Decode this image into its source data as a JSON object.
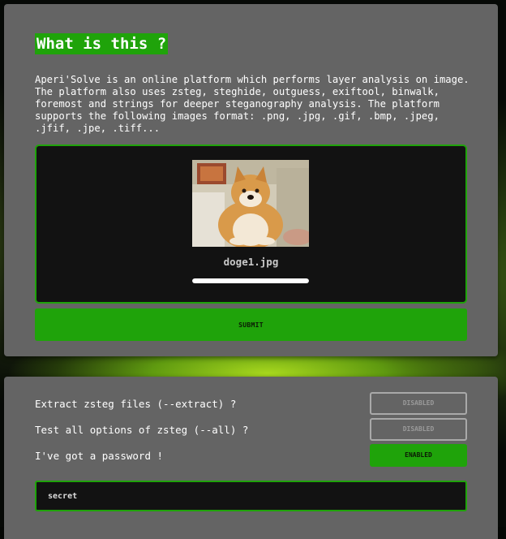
{
  "upload_section": {
    "title": "What is this ?",
    "description": "Aperi'Solve is an online platform which performs layer analysis on image. The platform also uses zsteg, steghide, outguess, exiftool, binwalk, foremost and strings for deeper steganography analysis. The platform supports the following images format: .png, .jpg, .gif, .bmp, .jpeg, .jfif, .jpe, .tiff...",
    "dropzone": {
      "image_icon": "doge-photo",
      "filename": "doge1.jpg",
      "upload_progress": 1.0
    },
    "submit_label": "SUBMIT"
  },
  "options_section": {
    "options": [
      {
        "label": "Extract zsteg files (--extract) ?",
        "state": "DISABLED"
      },
      {
        "label": "Test all options of zsteg (--all) ?",
        "state": "DISABLED"
      },
      {
        "label": "I've got a password !",
        "state": "ENABLED"
      }
    ],
    "password_value": "secret"
  },
  "colors": {
    "accent": "#1fa30a",
    "card": "#646464",
    "field": "#121212"
  }
}
